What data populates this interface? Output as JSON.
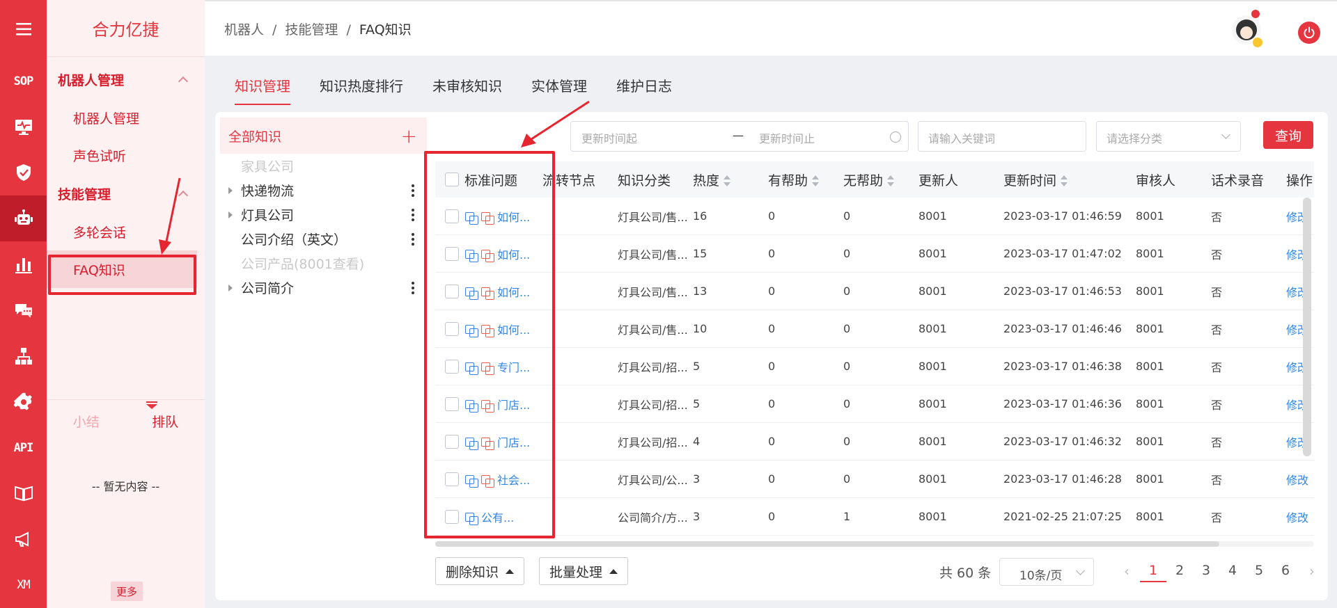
{
  "rail": {
    "items": [
      {
        "icon": "menu-icon"
      },
      {
        "text": "SOP"
      },
      {
        "icon": "monitor-icon"
      },
      {
        "icon": "shield-icon"
      },
      {
        "icon": "robot-icon",
        "active": true
      },
      {
        "icon": "bar-chart-icon"
      },
      {
        "icon": "chat-icon"
      },
      {
        "icon": "org-chart-icon"
      },
      {
        "icon": "gear-icon"
      },
      {
        "text": "API"
      },
      {
        "icon": "book-icon"
      },
      {
        "icon": "megaphone-icon"
      },
      {
        "text": "XM"
      }
    ]
  },
  "sidebar": {
    "brand": "合力亿捷",
    "group1": "机器人管理",
    "item1": "机器人管理",
    "item2": "声色试听",
    "group2": "技能管理",
    "item3": "多轮会话",
    "item4": "FAQ知识",
    "tab_summary": "小结",
    "tab_queue": "排队",
    "empty": "-- 暂无内容 --",
    "more": "更多"
  },
  "breadcrumb": {
    "a": "机器人",
    "b": "技能管理",
    "c": "FAQ知识",
    "sep": "/"
  },
  "tabs": [
    "知识管理",
    "知识热度排行",
    "未审核知识",
    "实体管理",
    "维护日志"
  ],
  "tree": {
    "header": "全部知识",
    "add": "+",
    "nodes": [
      {
        "label": "家具公司",
        "disabled": true
      },
      {
        "label": "快递物流",
        "caret": true,
        "kebab": true
      },
      {
        "label": "灯具公司",
        "caret": true,
        "kebab": true
      },
      {
        "label": "公司介绍（英文）",
        "kebab": true
      },
      {
        "label": "公司产品(8001查看)",
        "disabled": true
      },
      {
        "label": "公司简介",
        "caret": true,
        "kebab": true
      }
    ]
  },
  "filters": {
    "date_start": "更新时间起",
    "date_dash": "—",
    "date_end": "更新时间止",
    "keyword": "请输入关键词",
    "category": "请选择分类",
    "query": "查询"
  },
  "table": {
    "headers": [
      "标准问题",
      "流转节点",
      "知识分类",
      "热度",
      "有帮助",
      "无帮助",
      "更新人",
      "更新时间",
      "审核人",
      "话术录音",
      "操作"
    ],
    "rows": [
      {
        "q": "如何...",
        "node": "",
        "cat": "灯具公司/售...",
        "heat": "16",
        "help": "0",
        "nohelp": "0",
        "updater": "8001",
        "time": "2023-03-17 01:46:59",
        "reviewer": "8001",
        "audio": "否",
        "op": "修改",
        "red_icon": true
      },
      {
        "q": "如何...",
        "node": "",
        "cat": "灯具公司/售...",
        "heat": "15",
        "help": "0",
        "nohelp": "0",
        "updater": "8001",
        "time": "2023-03-17 01:47:02",
        "reviewer": "8001",
        "audio": "否",
        "op": "修改",
        "red_icon": true
      },
      {
        "q": "如何...",
        "node": "",
        "cat": "灯具公司/售...",
        "heat": "13",
        "help": "0",
        "nohelp": "0",
        "updater": "8001",
        "time": "2023-03-17 01:46:53",
        "reviewer": "8001",
        "audio": "否",
        "op": "修改",
        "red_icon": true
      },
      {
        "q": "如何...",
        "node": "",
        "cat": "灯具公司/售...",
        "heat": "10",
        "help": "0",
        "nohelp": "0",
        "updater": "8001",
        "time": "2023-03-17 01:46:46",
        "reviewer": "8001",
        "audio": "否",
        "op": "修改",
        "red_icon": true
      },
      {
        "q": "专门...",
        "node": "",
        "cat": "灯具公司/招...",
        "heat": "5",
        "help": "0",
        "nohelp": "0",
        "updater": "8001",
        "time": "2023-03-17 01:46:38",
        "reviewer": "8001",
        "audio": "否",
        "op": "修改",
        "red_icon": true
      },
      {
        "q": "门店...",
        "node": "",
        "cat": "灯具公司/招...",
        "heat": "5",
        "help": "0",
        "nohelp": "0",
        "updater": "8001",
        "time": "2023-03-17 01:46:36",
        "reviewer": "8001",
        "audio": "否",
        "op": "修改",
        "red_icon": true
      },
      {
        "q": "门店...",
        "node": "",
        "cat": "灯具公司/招...",
        "heat": "4",
        "help": "0",
        "nohelp": "0",
        "updater": "8001",
        "time": "2023-03-17 01:46:32",
        "reviewer": "8001",
        "audio": "否",
        "op": "修改",
        "red_icon": true
      },
      {
        "q": "社会...",
        "node": "",
        "cat": "灯具公司/公...",
        "heat": "3",
        "help": "0",
        "nohelp": "0",
        "updater": "8001",
        "time": "2023-03-17 01:46:28",
        "reviewer": "8001",
        "audio": "否",
        "op": "修改",
        "red_icon": true
      },
      {
        "q": "公有...",
        "node": "",
        "cat": "公司简介/方...",
        "heat": "3",
        "help": "0",
        "nohelp": "1",
        "updater": "8001",
        "time": "2021-02-25 21:07:25",
        "reviewer": "8001",
        "audio": "否",
        "op": "修改",
        "red_icon": false
      }
    ]
  },
  "footer": {
    "delete": "删除知识",
    "batch": "批量处理",
    "total": "共 60 条",
    "page_size": "10条/页",
    "pages": [
      "1",
      "2",
      "3",
      "4",
      "5",
      "6"
    ],
    "current_page": "1",
    "prev": "‹",
    "next": "›"
  },
  "colors": {
    "brand": "#e5353f",
    "link": "#2f86e8",
    "annotation": "#e5252f"
  }
}
